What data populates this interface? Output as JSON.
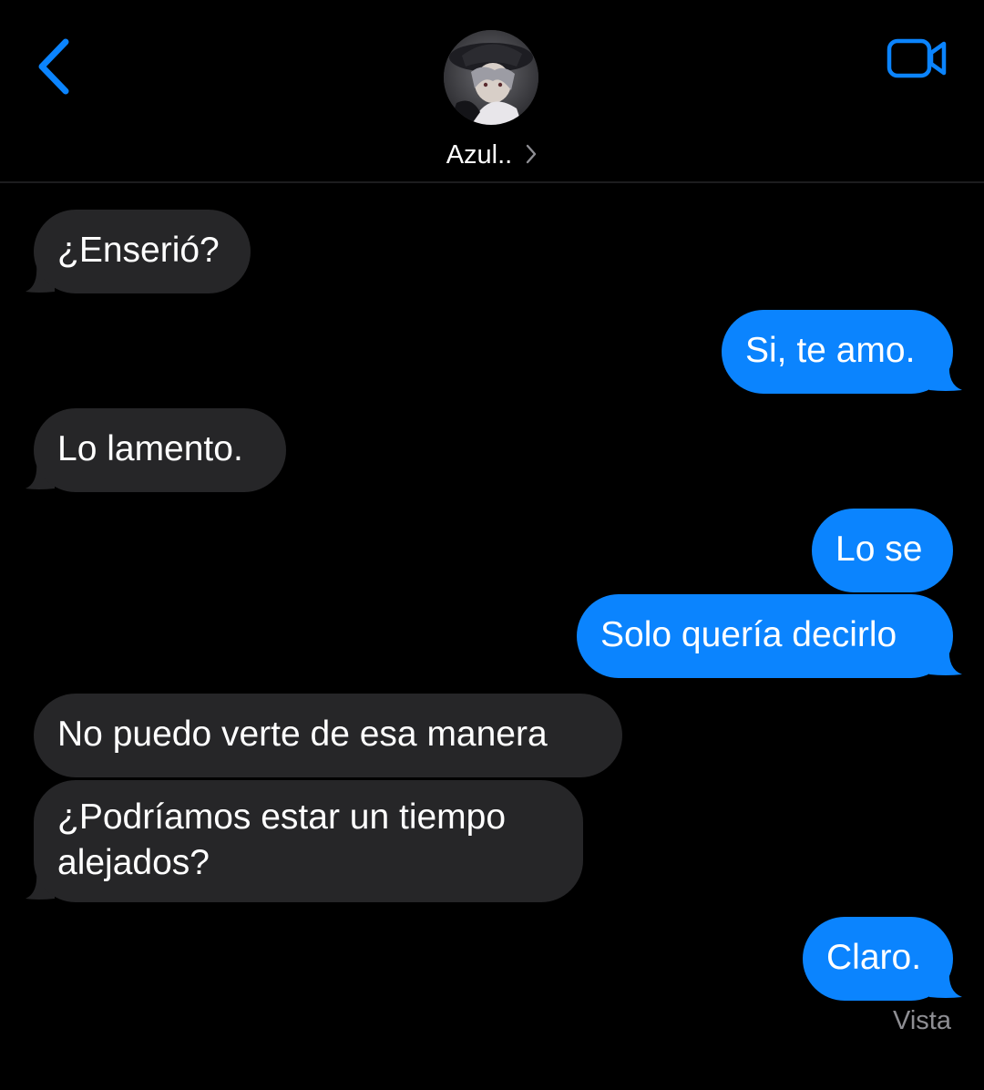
{
  "header": {
    "contact_name": "Azul..",
    "accent_color": "#0b84fe",
    "back_icon": "chevron-left-icon",
    "video_icon": "video-camera-icon",
    "disclosure_icon": "chevron-right-icon"
  },
  "messages": [
    {
      "direction": "in",
      "text": "¿Enserió?"
    },
    {
      "direction": "out",
      "text": "Si, te amo."
    },
    {
      "direction": "in",
      "text": "Lo lamento."
    },
    {
      "direction": "out",
      "text": "Lo se"
    },
    {
      "direction": "out",
      "text": "Solo quería decirlo"
    },
    {
      "direction": "in",
      "text": "No puedo verte de esa manera"
    },
    {
      "direction": "in",
      "text": "¿Podríamos estar un tiempo alejados?"
    },
    {
      "direction": "out",
      "text": "Claro."
    }
  ],
  "status": {
    "read_receipt": "Vista"
  },
  "colors": {
    "incoming_bubble": "#262628",
    "outgoing_bubble": "#0b84fe",
    "background": "#000000"
  }
}
